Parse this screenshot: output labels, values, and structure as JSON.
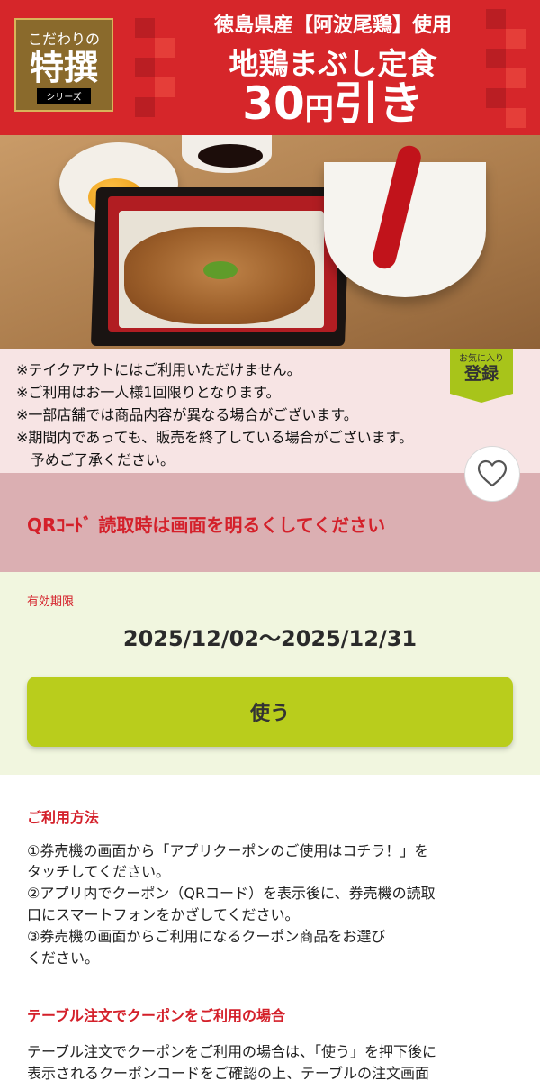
{
  "banner": {
    "badge_line1": "こだわりの",
    "badge_line2": "特撰",
    "badge_line3": "シリーズ",
    "title_line1": "徳島県産【阿波尾鶏】使用",
    "title_line2": "地鶏まぶし定食",
    "discount_number": "30",
    "discount_unit": "円",
    "discount_suffix": "引き"
  },
  "notes": [
    "※テイクアウトにはご利用いただけません。",
    "※ご利用はお一人様1回限りとなります。",
    "※一部店舗では商品内容が異なる場合がございます。",
    "※期間内であっても、販売を終了している場合がございます。",
    "　予めご了承ください。"
  ],
  "favorite": {
    "line1": "お気に入り",
    "line2": "登録"
  },
  "qr_notice": "QRｺｰﾄﾞ 読取時は画面を明るくしてください",
  "validity": {
    "label": "有効期限",
    "dates": "2025/12/02～2025/12/31",
    "use_button": "使う"
  },
  "usage": {
    "heading": "ご利用方法",
    "steps": [
      "①券売機の画面から「アプリクーポンのご使用はコチラ！」を",
      "タッチしてください。",
      "②アプリ内でクーポン（QRコード）を表示後に、券売機の読取",
      "口にスマートフォンをかざしてください。",
      "③券売機の画面からご利用になるクーポン商品をお選び",
      "ください。"
    ],
    "table_heading": "テーブル注文でクーポンをご利用の場合",
    "table_text": [
      "テーブル注文でクーポンをご利用の場合は、「使う」を押下後に",
      "表示されるクーポンコードをご確認の上、テーブルの注文画面"
    ]
  },
  "colors": {
    "banner_red": "#d6262a",
    "notes_bg": "#f7e4e4",
    "qr_bar_bg": "#dbafb2",
    "accent_red": "#d4202a",
    "validity_bg": "#f1f6df",
    "use_button": "#b9cd1c"
  },
  "icons": {
    "favorite": "heart-outline-icon"
  }
}
